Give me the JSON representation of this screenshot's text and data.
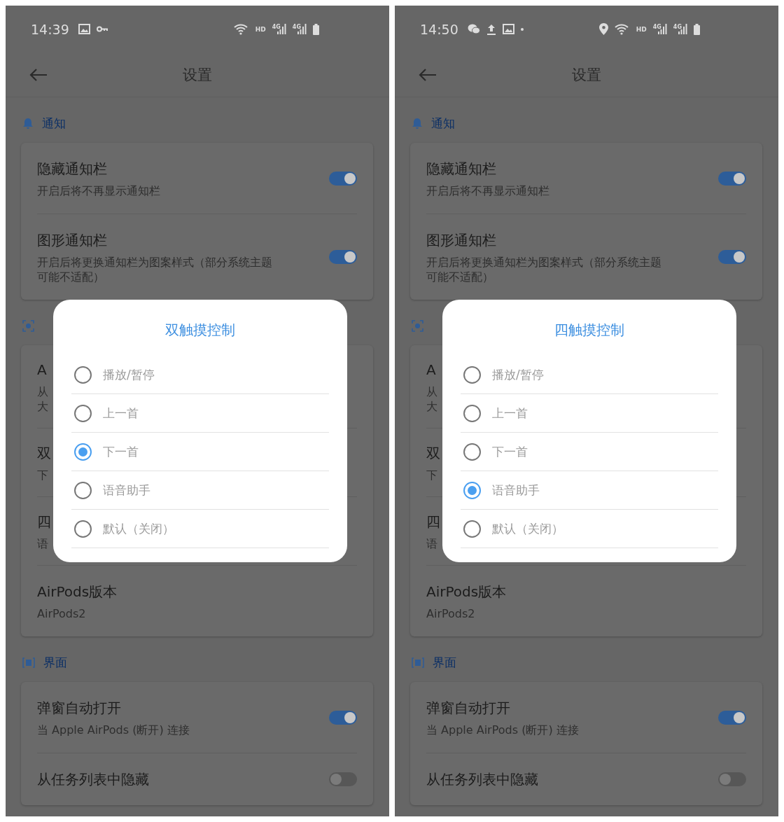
{
  "phones": [
    {
      "status_bar": {
        "time": "14:39",
        "notifications": [
          {
            "kind": "image"
          },
          {
            "kind": "key"
          }
        ],
        "hd": "HD",
        "sims": [
          "4G",
          "4G"
        ]
      },
      "app_bar": {
        "title": "设置"
      },
      "sections": [
        {
          "kind": "bell",
          "title": "通知",
          "rows": [
            {
              "kind": "toggle",
              "title": "隐藏通知栏",
              "subtitle": [
                "开启后将不再显示通知栏"
              ],
              "on": true
            },
            {
              "kind": "toggle",
              "title": "图形通知栏",
              "subtitle": [
                "开启后将更换通知栏为图案样式（部分系统主题",
                "可能不适配）"
              ],
              "on": true
            }
          ]
        },
        {
          "kind": "scan",
          "rows": [
            {
              "kind": "clipped",
              "title": "A",
              "subtitle": [
                "从",
                "大"
              ]
            },
            {
              "kind": "clipped",
              "title": "双",
              "subtitle": [
                "下"
              ]
            },
            {
              "kind": "clipped",
              "title": "四",
              "subtitle": [
                "语"
              ]
            },
            {
              "kind": "value",
              "title": "AirPods版本",
              "subtitle": [
                "AirPods2"
              ]
            }
          ]
        },
        {
          "kind": "window",
          "title": "界面",
          "rows": [
            {
              "kind": "toggle",
              "title": "弹窗自动打开",
              "subtitle": [
                "当 Apple AirPods (断开) 连接"
              ],
              "on": true
            },
            {
              "kind": "toggle",
              "title": "从任务列表中隐藏",
              "on": false
            }
          ]
        }
      ],
      "dialog": {
        "title": "双触摸控制",
        "options": [
          {
            "label": "播放/暂停",
            "selected": false
          },
          {
            "label": "上一首",
            "selected": false
          },
          {
            "label": "下一首",
            "selected": true
          },
          {
            "label": "语音助手",
            "selected": false
          },
          {
            "label": "默认（关闭）",
            "selected": false
          }
        ]
      }
    },
    {
      "status_bar": {
        "time": "14:50",
        "notifications": [
          {
            "kind": "chat"
          },
          {
            "kind": "upload"
          },
          {
            "kind": "image"
          },
          {
            "kind": "dot"
          }
        ],
        "location": true,
        "hd": "HD",
        "sims": [
          "4G",
          "4G"
        ]
      },
      "app_bar": {
        "title": "设置"
      },
      "sections": [
        {
          "kind": "bell",
          "title": "通知",
          "rows": [
            {
              "kind": "toggle",
              "title": "隐藏通知栏",
              "subtitle": [
                "开启后将不再显示通知栏"
              ],
              "on": true
            },
            {
              "kind": "toggle",
              "title": "图形通知栏",
              "subtitle": [
                "开启后将更换通知栏为图案样式（部分系统主题",
                "可能不适配）"
              ],
              "on": true
            }
          ]
        },
        {
          "kind": "scan",
          "rows": [
            {
              "kind": "clipped",
              "title": "A",
              "subtitle": [
                "从",
                "大"
              ]
            },
            {
              "kind": "clipped",
              "title": "双",
              "subtitle": [
                "下"
              ]
            },
            {
              "kind": "clipped",
              "title": "四",
              "subtitle": [
                "语"
              ]
            },
            {
              "kind": "value",
              "title": "AirPods版本",
              "subtitle": [
                "AirPods2"
              ]
            }
          ]
        },
        {
          "kind": "window",
          "title": "界面",
          "rows": [
            {
              "kind": "toggle",
              "title": "弹窗自动打开",
              "subtitle": [
                "当 Apple AirPods (断开) 连接"
              ],
              "on": true
            },
            {
              "kind": "toggle",
              "title": "从任务列表中隐藏",
              "on": false
            }
          ]
        }
      ],
      "dialog": {
        "title": "四触摸控制",
        "options": [
          {
            "label": "播放/暂停",
            "selected": false
          },
          {
            "label": "上一首",
            "selected": false
          },
          {
            "label": "下一首",
            "selected": false
          },
          {
            "label": "语音助手",
            "selected": true
          },
          {
            "label": "默认（关闭）",
            "selected": false
          }
        ]
      }
    }
  ]
}
